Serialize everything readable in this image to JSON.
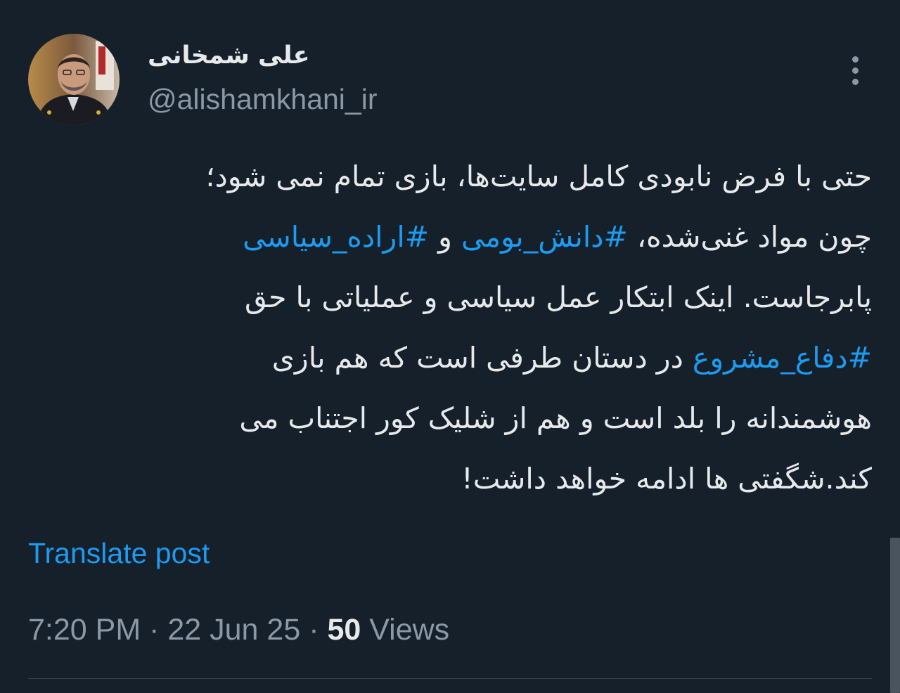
{
  "author": {
    "display_name": "علی شمخانی",
    "handle": "@alishamkhani_ir",
    "avatar_icon": "profile-photo"
  },
  "menu": {
    "icon": "more-vertical-icon"
  },
  "tweet": {
    "lines": [
      {
        "segments": [
          {
            "text": "حتی با فرض نابودی کامل سایت‌ها، بازی تمام نمی شود؛",
            "type": "text"
          }
        ]
      },
      {
        "segments": [
          {
            "text": "چون مواد غنی‌شده، ",
            "type": "text"
          },
          {
            "text": "#دانش_بومی",
            "type": "hashtag"
          },
          {
            "text": " و ",
            "type": "text"
          },
          {
            "text": "#اراده_سیاسی",
            "type": "hashtag"
          }
        ]
      },
      {
        "segments": [
          {
            "text": "پابرجاست. اینک ابتکار عمل سیاسی و عملیاتی با حق",
            "type": "text"
          }
        ]
      },
      {
        "segments": [
          {
            "text": "#دفاع_مشروع",
            "type": "hashtag"
          },
          {
            "text": " در دستان طرفی است که هم بازی",
            "type": "text"
          }
        ]
      },
      {
        "segments": [
          {
            "text": "هوشمندانه را بلد است و هم از شلیک کور اجتناب می",
            "type": "text"
          }
        ]
      },
      {
        "segments": [
          {
            "text": "کند.شگفتی ها ادامه خواهد داشت!",
            "type": "text"
          }
        ]
      }
    ]
  },
  "translate_label": "Translate post",
  "meta": {
    "time": "7:20 PM",
    "separator": " · ",
    "date": "22 Jun 25",
    "views_count": "50",
    "views_label": " Views"
  },
  "colors": {
    "background": "#15202b",
    "text": "#e7e9ea",
    "secondary": "#8b98a5",
    "link": "#1d9bf0"
  }
}
